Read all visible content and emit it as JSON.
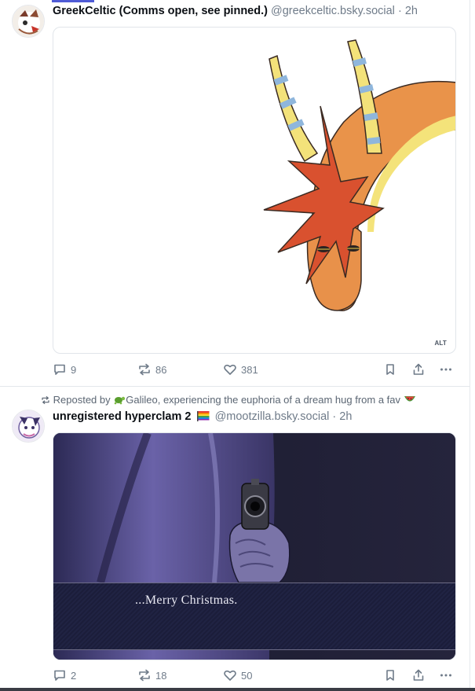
{
  "posts": [
    {
      "author": "GreekCeltic (Comms open, see pinned.)",
      "handle": "@greekceltic.bsky.social",
      "separator": "·",
      "time": "2h",
      "alt_badge": "ALT",
      "replies": "9",
      "reposts": "86",
      "likes": "381"
    },
    {
      "repost_prefix": "Reposted by",
      "reposter": "Galileo, experiencing the euphoria of a dream hug from a fav",
      "author": "unregistered hyperclam 2",
      "handle": "@mootzilla.bsky.social",
      "separator": "·",
      "time": "2h",
      "image_text": "...Merry Christmas.",
      "replies": "2",
      "reposts": "18",
      "likes": "50"
    }
  ],
  "icons": {
    "reply": "speech-bubble-icon",
    "repost": "repost-arrows-icon",
    "like": "heart-icon",
    "bookmark": "bookmark-icon",
    "share": "share-icon",
    "more": "more-dots-icon"
  },
  "colors": {
    "text_muted": "#6f7b89",
    "accent": "#4f5bd5"
  }
}
